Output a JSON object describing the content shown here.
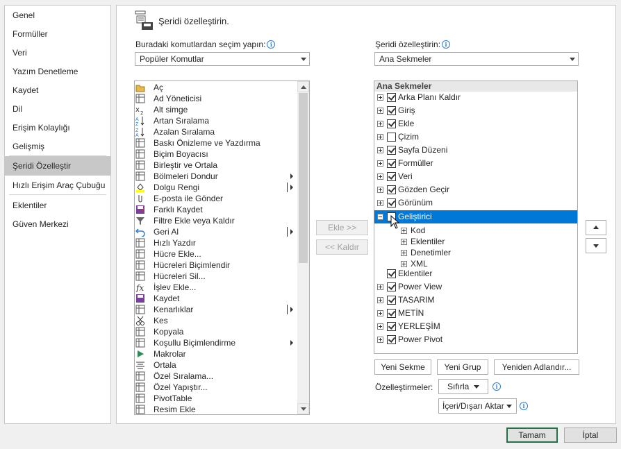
{
  "nav": {
    "items": [
      "Genel",
      "Formüller",
      "Veri",
      "Yazım Denetleme",
      "Kaydet",
      "Dil",
      "Erişim Kolaylığı",
      "Gelişmiş",
      "Şeridi Özelleştir",
      "Hızlı Erişim Araç Çubuğu",
      "Eklentiler",
      "Güven Merkezi"
    ],
    "selected": "Şeridi Özelleştir"
  },
  "header": {
    "title": "Şeridi özelleştirin."
  },
  "left": {
    "label": "Buradaki komutlardan seçim yapın:",
    "combo_value": "Popüler Komutlar",
    "commands": [
      {
        "label": "Aç",
        "icon": "folder-open-icon",
        "sub": false
      },
      {
        "label": "Ad Yöneticisi",
        "icon": "name-manager-icon",
        "sub": false
      },
      {
        "label": "Alt simge",
        "icon": "subscript-icon",
        "sub": false
      },
      {
        "label": "Artan Sıralama",
        "icon": "sort-asc-icon",
        "sub": false
      },
      {
        "label": "Azalan Sıralama",
        "icon": "sort-desc-icon",
        "sub": false
      },
      {
        "label": "Baskı Önizleme ve Yazdırma",
        "icon": "print-preview-icon",
        "sub": false
      },
      {
        "label": "Biçim Boyacısı",
        "icon": "format-painter-icon",
        "sub": false
      },
      {
        "label": "Birleştir ve Ortala",
        "icon": "merge-center-icon",
        "sub": false
      },
      {
        "label": "Bölmeleri Dondur",
        "icon": "freeze-panes-icon",
        "sub": "arrow"
      },
      {
        "label": "Dolgu Rengi",
        "icon": "fill-color-icon",
        "sub": "bar"
      },
      {
        "label": "E-posta ile Gönder",
        "icon": "email-icon",
        "sub": false
      },
      {
        "label": "Farklı Kaydet",
        "icon": "save-as-icon",
        "sub": false
      },
      {
        "label": "Filtre Ekle veya Kaldır",
        "icon": "filter-icon",
        "sub": false
      },
      {
        "label": "Geri Al",
        "icon": "undo-icon",
        "sub": "bar"
      },
      {
        "label": "Hızlı Yazdır",
        "icon": "quick-print-icon",
        "sub": false
      },
      {
        "label": "Hücre Ekle...",
        "icon": "insert-cells-icon",
        "sub": false
      },
      {
        "label": "Hücreleri Biçimlendir",
        "icon": "format-cells-icon",
        "sub": false
      },
      {
        "label": "Hücreleri Sil...",
        "icon": "delete-cells-icon",
        "sub": false
      },
      {
        "label": "İşlev Ekle...",
        "icon": "function-icon",
        "sub": false
      },
      {
        "label": "Kaydet",
        "icon": "save-icon",
        "sub": false
      },
      {
        "label": "Kenarlıklar",
        "icon": "borders-icon",
        "sub": "bar"
      },
      {
        "label": "Kes",
        "icon": "cut-icon",
        "sub": false
      },
      {
        "label": "Kopyala",
        "icon": "copy-icon",
        "sub": false
      },
      {
        "label": "Koşullu Biçimlendirme",
        "icon": "conditional-format-icon",
        "sub": "arrow"
      },
      {
        "label": "Makrolar",
        "icon": "macro-icon",
        "sub": false
      },
      {
        "label": "Ortala",
        "icon": "align-center-icon",
        "sub": false
      },
      {
        "label": "Özel Sıralama...",
        "icon": "custom-sort-icon",
        "sub": false
      },
      {
        "label": "Özel Yapıştır...",
        "icon": "paste-special-icon",
        "sub": false
      },
      {
        "label": "PivotTable",
        "icon": "pivot-table-icon",
        "sub": false
      },
      {
        "label": "Resim Ekle",
        "icon": "picture-icon",
        "sub": false
      }
    ]
  },
  "middle": {
    "add_label": "Ekle >>",
    "remove_label": "<< Kaldır"
  },
  "right": {
    "label": "Şeridi özelleştirin:",
    "combo_value": "Ana Sekmeler",
    "tree_header": "Ana Sekmeler",
    "tabs": [
      {
        "label": "Arka Planı Kaldır",
        "checked": true,
        "expand": "plus",
        "level": 0
      },
      {
        "label": "Giriş",
        "checked": true,
        "expand": "plus",
        "level": 0
      },
      {
        "label": "Ekle",
        "checked": true,
        "expand": "plus",
        "level": 0
      },
      {
        "label": "Çizim",
        "checked": false,
        "expand": "plus",
        "level": 0
      },
      {
        "label": "Sayfa Düzeni",
        "checked": true,
        "expand": "plus",
        "level": 0
      },
      {
        "label": "Formüller",
        "checked": true,
        "expand": "plus",
        "level": 0
      },
      {
        "label": "Veri",
        "checked": true,
        "expand": "plus",
        "level": 0
      },
      {
        "label": "Gözden Geçir",
        "checked": true,
        "expand": "plus",
        "level": 0
      },
      {
        "label": "Görünüm",
        "checked": true,
        "expand": "plus",
        "level": 0
      },
      {
        "label": "Geliştirici",
        "checked": false,
        "expand": "minus",
        "level": 0,
        "selected": true
      },
      {
        "label": "Kod",
        "checked": null,
        "expand": "plus",
        "level": 1
      },
      {
        "label": "Eklentiler",
        "checked": null,
        "expand": "plus",
        "level": 1
      },
      {
        "label": "Denetimler",
        "checked": null,
        "expand": "plus",
        "level": 1
      },
      {
        "label": "XML",
        "checked": null,
        "expand": "plus",
        "level": 1
      },
      {
        "label": "Eklentiler",
        "checked": true,
        "expand": null,
        "level": 0
      },
      {
        "label": "Power View",
        "checked": true,
        "expand": "plus",
        "level": 0
      },
      {
        "label": "TASARIM",
        "checked": true,
        "expand": "plus",
        "level": 0
      },
      {
        "label": "METİN",
        "checked": true,
        "expand": "plus",
        "level": 0
      },
      {
        "label": "YERLEŞİM",
        "checked": true,
        "expand": "plus",
        "level": 0
      },
      {
        "label": "Power Pivot",
        "checked": true,
        "expand": "plus",
        "level": 0
      }
    ],
    "new_tab": "Yeni Sekme",
    "new_group": "Yeni Grup",
    "rename": "Yeniden Adlandır...",
    "customizations_label": "Özelleştirmeler:",
    "reset": "Sıfırla",
    "import_export": "İçeri/Dışarı Aktar"
  },
  "footer": {
    "ok": "Tamam",
    "cancel": "İptal"
  },
  "colors": {
    "accent": "#0078d7",
    "ok_border": "#217346"
  }
}
